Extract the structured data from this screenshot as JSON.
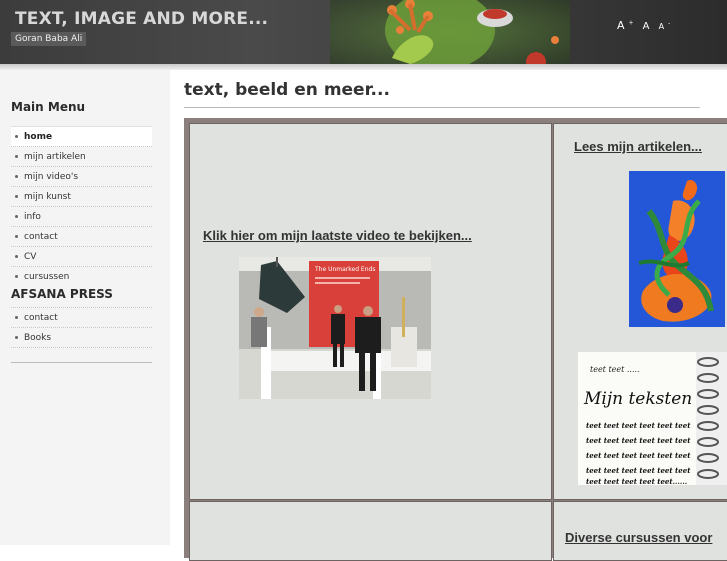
{
  "header": {
    "title": "TEXT, IMAGE AND MORE...",
    "subtitle": "Goran Baba Ali",
    "font_sizer": {
      "large": "A",
      "medium": "A",
      "small": "A",
      "plus": "+",
      "minus": "-"
    }
  },
  "sidebar": {
    "main_menu_heading": "Main Menu",
    "main_menu": [
      {
        "label": "home"
      },
      {
        "label": "mijn artikelen"
      },
      {
        "label": "mijn video's"
      },
      {
        "label": "mijn kunst"
      },
      {
        "label": "info"
      },
      {
        "label": "contact"
      },
      {
        "label": "CV"
      },
      {
        "label": "cursussen"
      }
    ],
    "press_heading": "AFSANA PRESS",
    "press_menu": [
      {
        "label": "contact"
      },
      {
        "label": "Books"
      }
    ]
  },
  "main": {
    "heading": "text, beeld en meer...",
    "video_link": "Klik hier om mijn laatste video te bekijken...",
    "video_poster_text": "The Unmarked Ends",
    "articles_link": "Lees mijn artikelen...",
    "teksten_card": {
      "top": "teet teet .....",
      "title": "Mijn teksten",
      "lines": [
        "teet teet teet teet teet teet",
        "teet teet teet teet teet teet",
        "teet teet teet teet teet teet",
        "teet teet teet teet teet teet",
        "teet teet teet teet teet......"
      ]
    },
    "courses_link": "Diverse cursussen voor"
  },
  "colors": {
    "header_bg": "#3f3f3f",
    "sidebar_bg": "#f4f4f4",
    "cell_bg": "#dfe2df",
    "table_border": "#8a7f7c"
  }
}
